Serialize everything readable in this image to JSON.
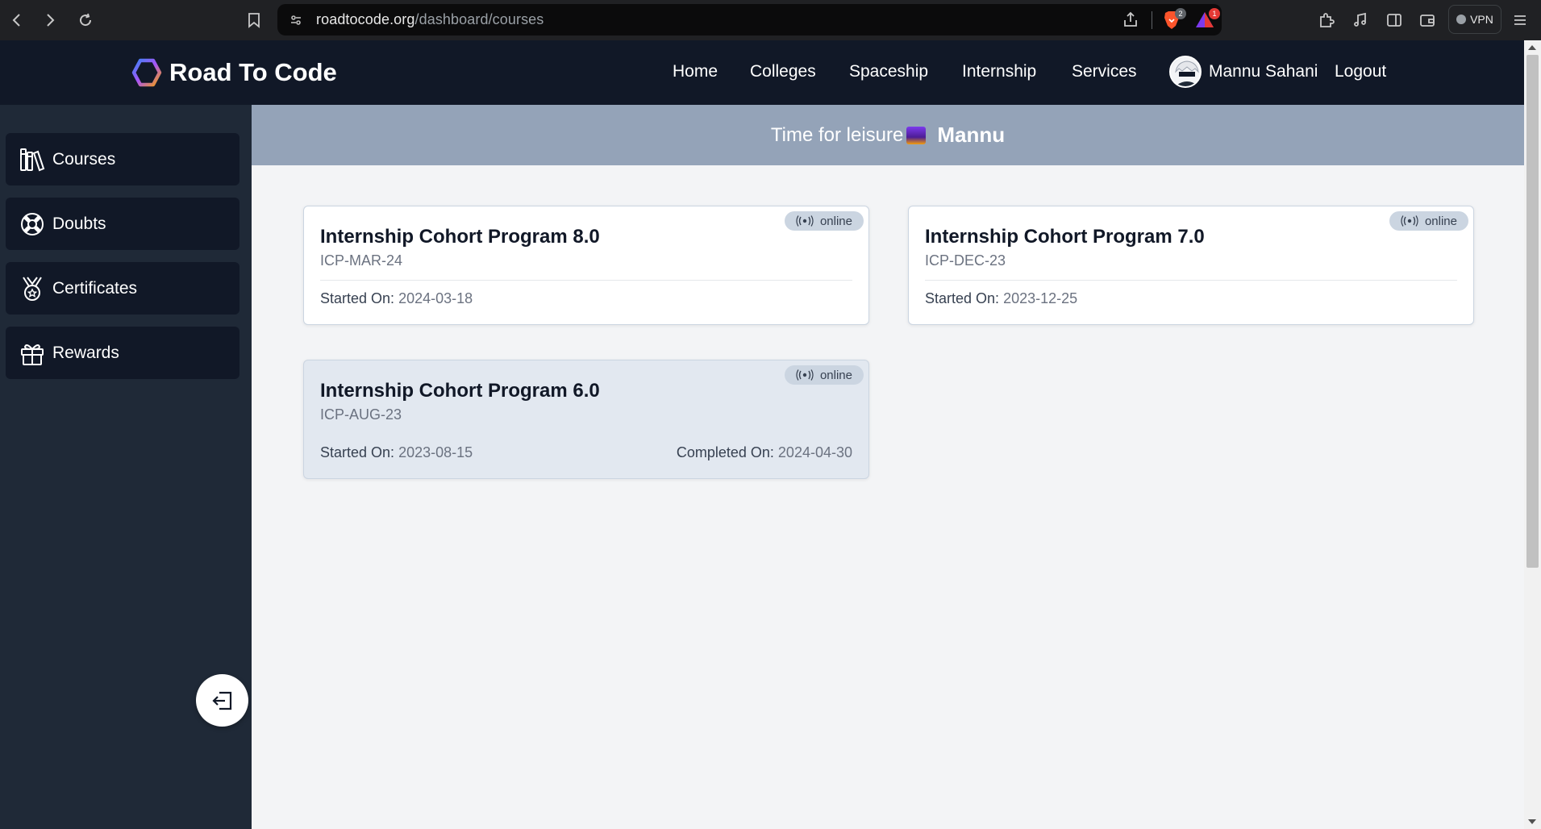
{
  "browser": {
    "url_host": "roadtocode.org",
    "url_path": "/dashboard/courses",
    "brave_badge": "2",
    "alert_badge": "1",
    "vpn_label": "VPN"
  },
  "nav": {
    "brand": "Road To Code",
    "links": [
      "Home",
      "Colleges",
      "Spaceship",
      "Internship",
      "Services"
    ],
    "user_name": "Mannu Sahani",
    "logout": "Logout"
  },
  "sidebar": {
    "items": [
      {
        "label": "Courses",
        "icon": "books-icon"
      },
      {
        "label": "Doubts",
        "icon": "lifebuoy-icon"
      },
      {
        "label": "Certificates",
        "icon": "medal-icon"
      },
      {
        "label": "Rewards",
        "icon": "gift-icon"
      }
    ]
  },
  "greeting": {
    "text": "Time for leisure",
    "name": "Mannu"
  },
  "courses": [
    {
      "title": "Internship Cohort Program 8.0",
      "code": "ICP-MAR-24",
      "mode": "online",
      "started_label": "Started On:",
      "started": "2024-03-18"
    },
    {
      "title": "Internship Cohort Program 7.0",
      "code": "ICP-DEC-23",
      "mode": "online",
      "started_label": "Started On:",
      "started": "2023-12-25"
    },
    {
      "title": "Internship Cohort Program 6.0",
      "code": "ICP-AUG-23",
      "mode": "online",
      "started_label": "Started On:",
      "started": "2023-08-15",
      "completed_label": "Completed On:",
      "completed": "2024-04-30"
    }
  ],
  "colors": {
    "nav_bg": "#111827",
    "sidebar_bg": "#1f2937",
    "greeting_bg": "#94a3b8",
    "main_bg": "#f3f4f6",
    "completed_card_bg": "#e2e8f0"
  }
}
